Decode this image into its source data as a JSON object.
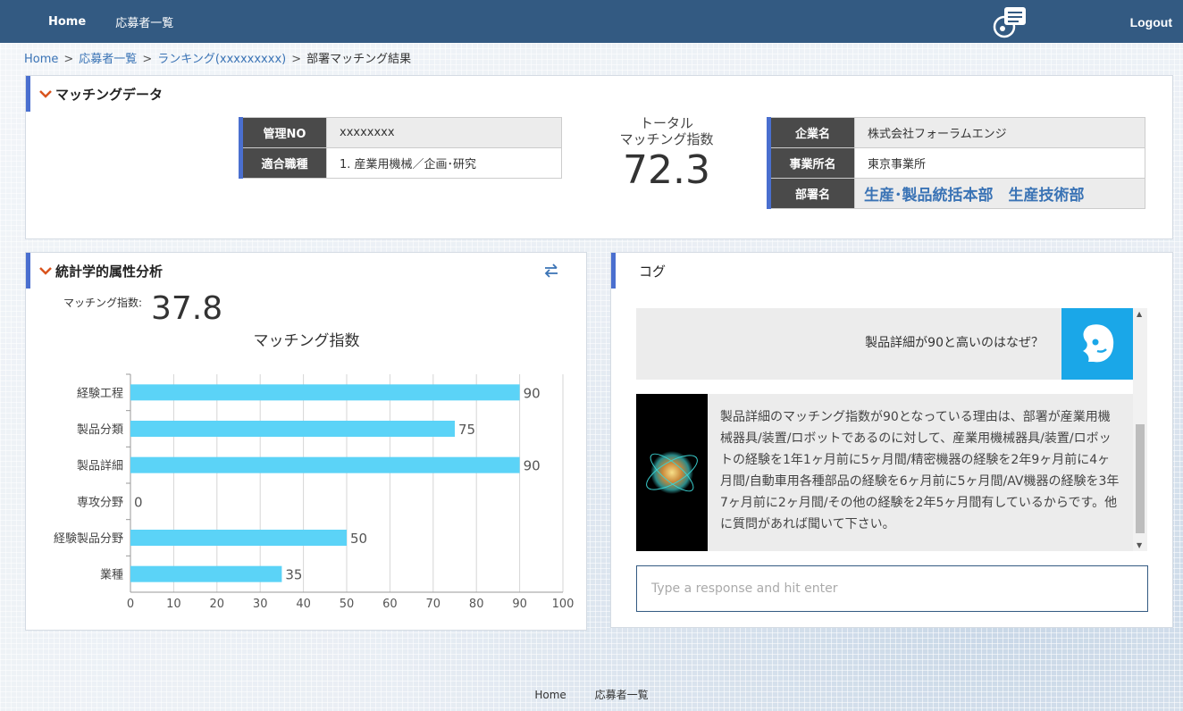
{
  "nav": {
    "home": "Home",
    "applicants": "応募者一覧",
    "logout": "Logout"
  },
  "breadcrumb": [
    "Home",
    "応募者一覧",
    "ランキング(xxxxxxxxx)",
    "部署マッチング結果"
  ],
  "breadcrumb_sep": ">",
  "matching": {
    "title": "マッチングデータ",
    "left": [
      {
        "key": "管理NO",
        "value": "xxxxxxxx"
      },
      {
        "key": "適合職種",
        "value": "1. 産業用機械／企画･研究"
      }
    ],
    "total_label_1": "トータル",
    "total_label_2": "マッチング指数",
    "total_value": "72.3",
    "right": [
      {
        "key": "企業名",
        "value": "株式会社フォーラムエンジ"
      },
      {
        "key": "事業所名",
        "value": "東京事業所"
      },
      {
        "key": "部署名",
        "value": "生産･製品統括本部　生産技術部"
      }
    ]
  },
  "stats": {
    "title": "統計学的属性分析",
    "match_label": "マッチング指数:",
    "match_value": "37.8"
  },
  "chart_data": {
    "type": "bar",
    "orientation": "horizontal",
    "title": "マッチング指数",
    "categories": [
      "経験工程",
      "製品分類",
      "製品詳細",
      "専攻分野",
      "経験製品分野",
      "業種"
    ],
    "values": [
      90,
      75,
      90,
      0,
      50,
      35
    ],
    "xlim": [
      0,
      100
    ],
    "xticks": [
      0,
      10,
      20,
      30,
      40,
      50,
      60,
      70,
      80,
      90,
      100
    ],
    "grid": true,
    "bar_color": "#5bd3f7"
  },
  "log": {
    "title": "コグ",
    "question": "製品詳細が90と高いのはなぜ？",
    "answer": "製品詳細のマッチング指数が90となっている理由は、部署が産業用機械器具/装置/ロボットであるのに対して、産業用機械器具/装置/ロボットの経験を1年1ヶ月前に5ヶ月間/精密機器の経験を2年9ヶ月前に4ヶ月間/自動車用各種部品の経験を6ヶ月前に5ヶ月間/AV機器の経験を3年7ヶ月前に2ヶ月間/その他の経験を2年5ヶ月間有しているからです。他に質問があれば聞いて下さい。",
    "input_placeholder": "Type a response and hit enter"
  },
  "footer": {
    "home": "Home",
    "applicants": "応募者一覧"
  },
  "colors": {
    "navbar": "#335a82",
    "accent": "#4a6fcf",
    "link": "#3a73b5",
    "bot_avatar": "#1aa7e8"
  }
}
